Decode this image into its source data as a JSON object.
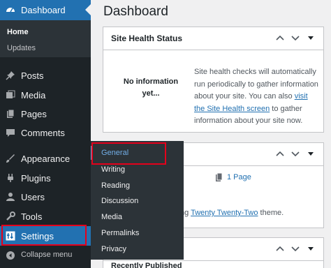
{
  "sidebar": {
    "dashboard_label": "Dashboard",
    "submenu": [
      "Home",
      "Updates"
    ],
    "items": [
      "Posts",
      "Media",
      "Pages",
      "Comments",
      "Appearance",
      "Plugins",
      "Users",
      "Tools",
      "Settings"
    ],
    "collapse_label": "Collapse menu"
  },
  "flyout": {
    "items": [
      "General",
      "Writing",
      "Reading",
      "Discussion",
      "Media",
      "Permalinks",
      "Privacy"
    ]
  },
  "main": {
    "title": "Dashboard",
    "site_health": {
      "title": "Site Health Status",
      "no_info_line1": "No information",
      "no_info_line2": "yet...",
      "text_before": "Site health checks will automatically run periodically to gather information about your site. You can also ",
      "link": "visit the Site Health screen",
      "text_after": " to gather information about your site now."
    },
    "glance": {
      "pages": "1 Page",
      "theme_prefix": "ng ",
      "theme_link": "Twenty Twenty-Two",
      "theme_suffix": " theme."
    },
    "activity": {
      "recent": "Recently Published"
    }
  },
  "colors": {
    "accent": "#2271b1",
    "sidebar": "#1d2327",
    "highlight": "#e5001b"
  }
}
